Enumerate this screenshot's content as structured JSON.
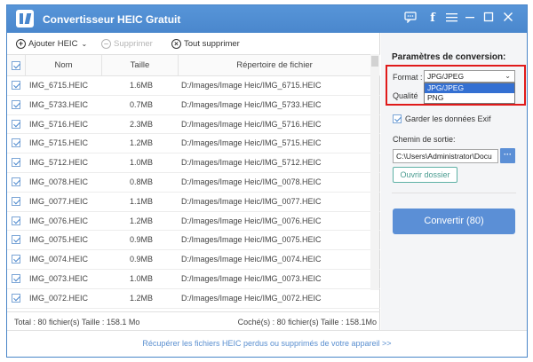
{
  "app": {
    "title": "Convertisseur HEIC Gratuit"
  },
  "toolbar": {
    "add_label": "Ajouter HEIC",
    "delete_label": "Supprimer",
    "delete_all_label": "Tout supprimer"
  },
  "table": {
    "headers": {
      "name": "Nom",
      "size": "Taille",
      "dir": "Répertoire de fichier"
    },
    "rows": [
      {
        "name": "IMG_6715.HEIC",
        "size": "1.6MB",
        "dir": "D:/Images/Image Heic/IMG_6715.HEIC"
      },
      {
        "name": "IMG_5733.HEIC",
        "size": "0.7MB",
        "dir": "D:/Images/Image Heic/IMG_5733.HEIC"
      },
      {
        "name": "IMG_5716.HEIC",
        "size": "2.3MB",
        "dir": "D:/Images/Image Heic/IMG_5716.HEIC"
      },
      {
        "name": "IMG_5715.HEIC",
        "size": "1.2MB",
        "dir": "D:/Images/Image Heic/IMG_5715.HEIC"
      },
      {
        "name": "IMG_5712.HEIC",
        "size": "1.0MB",
        "dir": "D:/Images/Image Heic/IMG_5712.HEIC"
      },
      {
        "name": "IMG_0078.HEIC",
        "size": "0.8MB",
        "dir": "D:/Images/Image Heic/IMG_0078.HEIC"
      },
      {
        "name": "IMG_0077.HEIC",
        "size": "1.1MB",
        "dir": "D:/Images/Image Heic/IMG_0077.HEIC"
      },
      {
        "name": "IMG_0076.HEIC",
        "size": "1.2MB",
        "dir": "D:/Images/Image Heic/IMG_0076.HEIC"
      },
      {
        "name": "IMG_0075.HEIC",
        "size": "0.9MB",
        "dir": "D:/Images/Image Heic/IMG_0075.HEIC"
      },
      {
        "name": "IMG_0074.HEIC",
        "size": "0.9MB",
        "dir": "D:/Images/Image Heic/IMG_0074.HEIC"
      },
      {
        "name": "IMG_0073.HEIC",
        "size": "1.0MB",
        "dir": "D:/Images/Image Heic/IMG_0073.HEIC"
      },
      {
        "name": "IMG_0072.HEIC",
        "size": "1.2MB",
        "dir": "D:/Images/Image Heic/IMG_0072.HEIC"
      }
    ]
  },
  "status": {
    "left": "Total : 80 fichier(s) Taille : 158.1 Mo",
    "right": "Coché(s) : 80 fichier(s) Taille : 158.1Mo"
  },
  "settings": {
    "title": "Paramètres de conversion:",
    "format_label": "Format :",
    "format_value": "JPG/JPEG",
    "format_options": [
      "JPG/JPEG",
      "PNG"
    ],
    "quality_label": "Qualité",
    "exif_label": "Garder les données Exif",
    "output_label": "Chemin de sortie:",
    "output_path": "C:\\Users\\Administrator\\Docu",
    "browse_label": "···",
    "open_folder_label": "Ouvrir dossier",
    "convert_label": "Convertir (80)"
  },
  "footer": {
    "link": "Récupérer les fichiers HEIC perdus ou supprimés de votre appareil >>"
  },
  "colors": {
    "accent": "#4a87cd",
    "button": "#5b8fd6",
    "highlight": "#e01a1a",
    "selected_option": "#3470d2"
  }
}
